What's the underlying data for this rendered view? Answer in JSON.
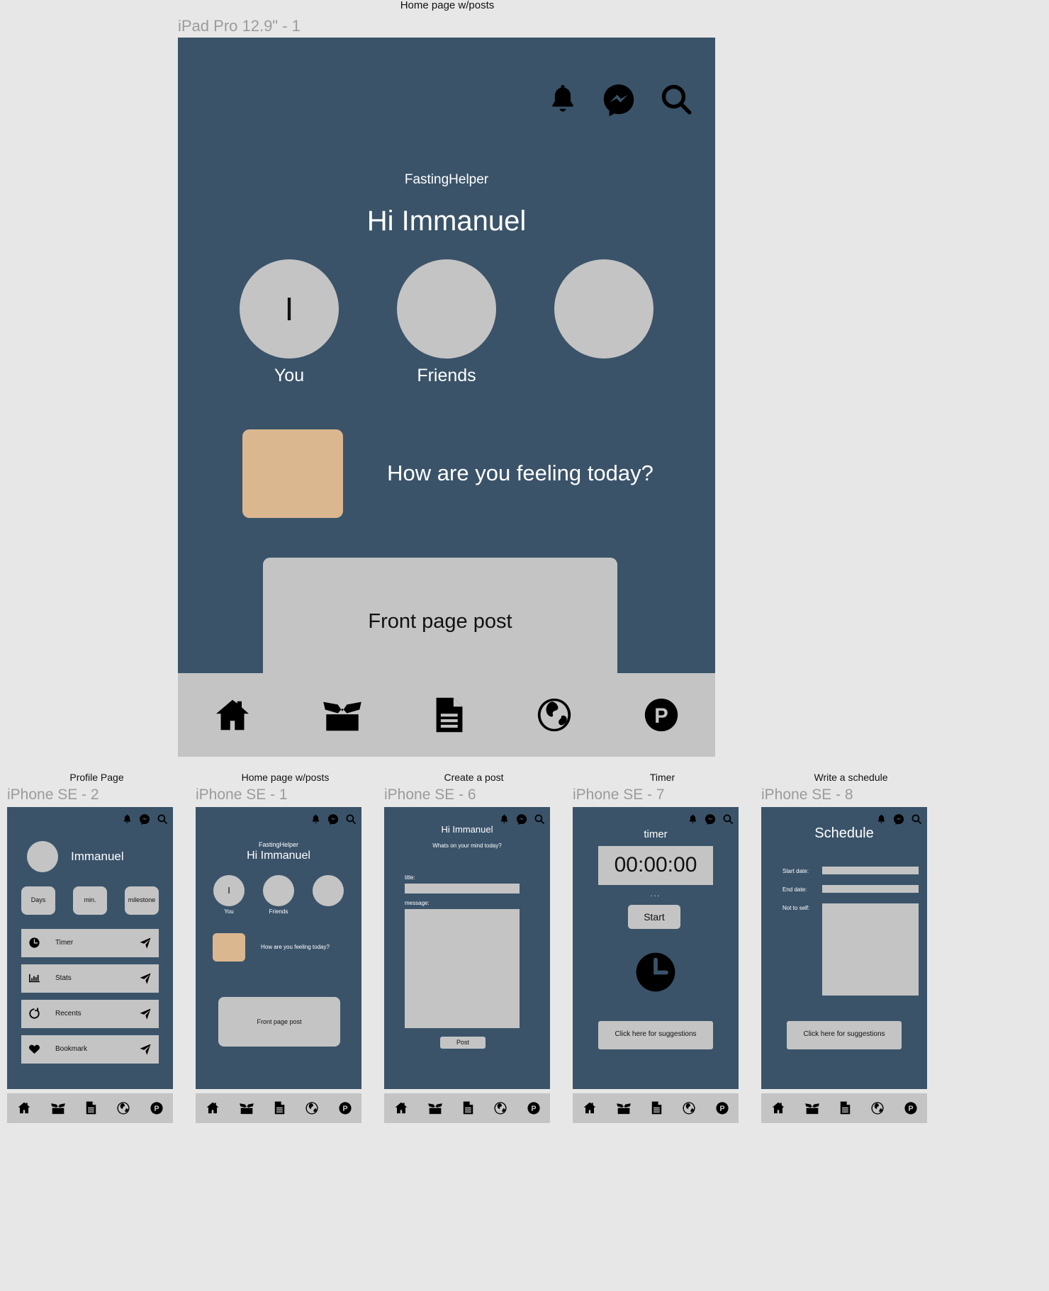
{
  "app": {
    "name": "FastingHelper",
    "user": "Immanuel",
    "accent": "#3a5369",
    "panel": "#c4c4c4",
    "tile": "#dbb78f",
    "page_bg": "#e7e7e7"
  },
  "top_icons": [
    {
      "name": "bell-icon",
      "label": "Notifications"
    },
    {
      "name": "messenger-icon",
      "label": "Messages"
    },
    {
      "name": "search-icon",
      "label": "Search"
    }
  ],
  "tabbar": [
    {
      "name": "home-icon",
      "label": "Home"
    },
    {
      "name": "open-box-icon",
      "label": "Box"
    },
    {
      "name": "document-icon",
      "label": "Document"
    },
    {
      "name": "globe-icon",
      "label": "Globe"
    },
    {
      "name": "p-circle-icon",
      "label": "P"
    }
  ],
  "ipad": {
    "caption": "Home page w/posts",
    "device": "iPad Pro 12.9\" - 1",
    "app_name": "FastingHelper",
    "greeting": "Hi Immanuel",
    "avatars": [
      {
        "initial": "I",
        "label": "You"
      },
      {
        "initial": "",
        "label": "Friends"
      },
      {
        "initial": "",
        "label": ""
      }
    ],
    "mood_question": "How are you feeling today?",
    "post_label": "Front page post"
  },
  "phones": [
    {
      "caption": "Profile Page",
      "device": "iPhone SE - 2",
      "kind": "profile",
      "name": "Immanuel",
      "stats": [
        "Days",
        "min.",
        "milestone"
      ],
      "rows": [
        {
          "icon": "clock-icon",
          "label": "Timer",
          "go": "send-icon"
        },
        {
          "icon": "bar-chart-icon",
          "label": "Stats",
          "go": "send-icon"
        },
        {
          "icon": "refresh-circle-icon",
          "label": "Recents",
          "go": "send-icon"
        },
        {
          "icon": "heart-icon",
          "label": "Bookmark",
          "go": "send-icon"
        }
      ]
    },
    {
      "caption": "Home page w/posts",
      "device": "iPhone SE - 1",
      "kind": "home",
      "app_name": "FastingHelper",
      "greeting": "Hi Immanuel",
      "avatars": [
        {
          "initial": "I",
          "label": "You"
        },
        {
          "initial": "",
          "label": "Friends"
        },
        {
          "initial": "",
          "label": ""
        }
      ],
      "mood_question": "How are you feeling today?",
      "post_label": "Front page post"
    },
    {
      "caption": "Create a post",
      "device": "iPhone SE - 6",
      "kind": "create",
      "greeting": "Hi Immanuel",
      "subtitle": "Whats on your mind today?",
      "title_label": "title:",
      "title_value": "",
      "message_label": "message:",
      "message_value": "",
      "post_button": "Post"
    },
    {
      "caption": "Timer",
      "device": "iPhone SE - 7",
      "kind": "timer",
      "title": "timer",
      "display": "00:00:00",
      "dots": "...",
      "start_button": "Start",
      "clock_icon": "clock-icon",
      "suggestions_button": "Click here for suggestions"
    },
    {
      "caption": "Write a schedule",
      "device": "iPhone SE - 8",
      "kind": "schedule",
      "title": "Schedule",
      "fields": [
        {
          "label": "Start date:",
          "value": ""
        },
        {
          "label": "End date:",
          "value": ""
        },
        {
          "label": "Not to self:",
          "value": ""
        }
      ],
      "suggestions_button": "Click here for suggestions"
    }
  ]
}
